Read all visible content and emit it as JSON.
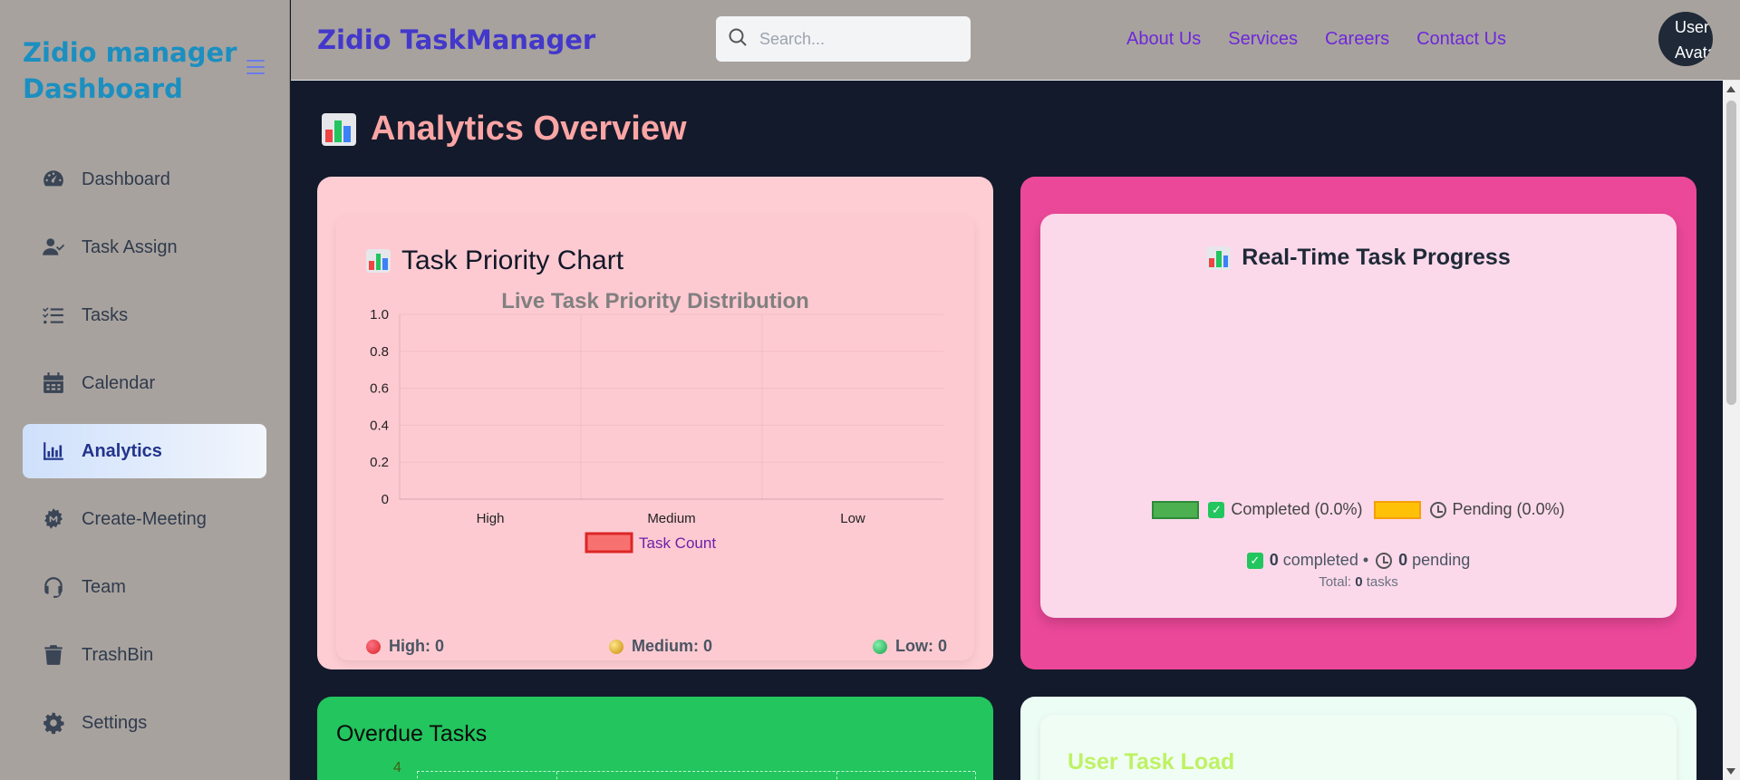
{
  "sidebar": {
    "brand": "Zidio manager Dashboard",
    "items": [
      {
        "label": "Dashboard",
        "icon": "gauge-icon",
        "active": false
      },
      {
        "label": "Task Assign",
        "icon": "user-check-icon",
        "active": false
      },
      {
        "label": "Tasks",
        "icon": "list-check-icon",
        "active": false
      },
      {
        "label": "Calendar",
        "icon": "calendar-icon",
        "active": false
      },
      {
        "label": "Analytics",
        "icon": "bar-chart-icon",
        "active": true
      },
      {
        "label": "Create-Meeting",
        "icon": "meeting-icon",
        "active": false
      },
      {
        "label": "Team",
        "icon": "headset-icon",
        "active": false
      },
      {
        "label": "TrashBin",
        "icon": "trash-icon",
        "active": false
      },
      {
        "label": "Settings",
        "icon": "gear-icon",
        "active": false
      }
    ]
  },
  "header": {
    "title": "Zidio TaskManager",
    "search_placeholder": "Search...",
    "links": [
      "About Us",
      "Services",
      "Careers",
      "Contact Us"
    ],
    "avatar_alt": "User Avatar"
  },
  "main": {
    "title": "Analytics Overview",
    "priority_card": {
      "heading": "Task Priority Chart",
      "stats": {
        "high": "High: 0",
        "medium": "Medium: 0",
        "low": "Low: 0"
      }
    },
    "progress_card": {
      "heading": "Real-Time Task Progress",
      "legend_completed": "Completed (0.0%)",
      "legend_pending": "Pending (0.0%)",
      "completed_count": "0",
      "completed_label": "completed •",
      "pending_count": "0",
      "pending_label": "pending",
      "total_prefix": "Total:",
      "total_count": "0",
      "total_suffix": "tasks"
    },
    "overdue_card": {
      "heading": "Overdue Tasks",
      "axis_value": "4"
    },
    "user_load_card": {
      "heading": "User Task Load"
    }
  },
  "colors": {
    "accent": "#4338ca",
    "high": "#ef4444",
    "medium": "#eab308",
    "low": "#22c55e",
    "completed": "#4caf50",
    "pending": "#ffc107",
    "bar_fill": "#f87171"
  },
  "chart_data": [
    {
      "type": "bar",
      "title": "Live Task Priority Distribution",
      "categories": [
        "High",
        "Medium",
        "Low"
      ],
      "series": [
        {
          "name": "Task Count",
          "values": [
            0,
            0,
            0
          ]
        }
      ],
      "ylim": [
        0,
        1
      ],
      "yticks": [
        "0",
        "0.2",
        "0.4",
        "0.6",
        "0.8",
        "1.0"
      ],
      "legend_position": "bottom",
      "grid": true
    },
    {
      "type": "pie",
      "categories": [
        "Completed (0.0%)",
        "Pending (0.0%)"
      ],
      "values": [
        0,
        0
      ],
      "legend_position": "bottom"
    }
  ]
}
